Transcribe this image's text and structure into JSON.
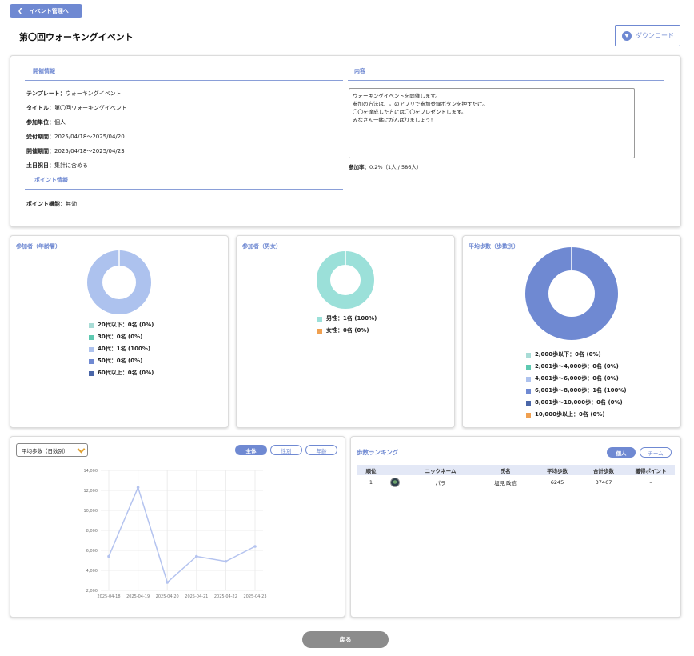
{
  "header": {
    "back_label": "イベント管理へ",
    "title": "第〇回ウォーキングイベント",
    "download_label": "ダウンロード"
  },
  "info": {
    "section_event": "開催情報",
    "section_content": "内容",
    "section_point": "ポイント情報",
    "rows": [
      {
        "label": "テンプレート：",
        "value": "ウォーキングイベント"
      },
      {
        "label": "タイトル：",
        "value": "第〇回ウォーキングイベント"
      },
      {
        "label": "参加単位：",
        "value": "個人"
      },
      {
        "label": "受付期間：",
        "value": "2025/04/18〜2025/04/20"
      },
      {
        "label": "開催期間：",
        "value": "2025/04/18〜2025/04/23"
      },
      {
        "label": "土日祝日：",
        "value": "集計に含める"
      }
    ],
    "point_row": {
      "label": "ポイント機能：",
      "value": "無効"
    },
    "content_lines": [
      "ウォーキングイベントを開催します。",
      "参加の方法は、このアプリで参加登録ボタンを押すだけ。",
      "〇〇を達成した方には〇〇をプレゼントします。",
      "みなさん一緒にがんばりましょう！"
    ],
    "rate_label": "参加率：",
    "rate_value": "0.2%（1人 / 586人）"
  },
  "charts": {
    "age": {
      "title": "参加者（年齢層）",
      "legend": [
        {
          "label": "20代以下：0名 (0%)",
          "color": "#a8dcd6"
        },
        {
          "label": "30代：0名 (0%)",
          "color": "#5ec9b1"
        },
        {
          "label": "40代：1名 (100%)",
          "color": "#adc2ee"
        },
        {
          "label": "50代：0名 (0%)",
          "color": "#6f89d2"
        },
        {
          "label": "60代以上：0名 (0%)",
          "color": "#4a66a8"
        }
      ]
    },
    "gender": {
      "title": "参加者（男女）",
      "legend": [
        {
          "label": "男性：1名 (100%)",
          "color": "#9be0d9"
        },
        {
          "label": "女性：0名 (0%)",
          "color": "#f0a050"
        }
      ]
    },
    "steps": {
      "title": "平均歩数（歩数別）",
      "legend": [
        {
          "label": "2,000歩以下：0名 (0%)",
          "color": "#a8dcd6"
        },
        {
          "label": "2,001歩〜4,000歩：0名 (0%)",
          "color": "#5ec9b1"
        },
        {
          "label": "4,001歩〜6,000歩：0名 (0%)",
          "color": "#adc2ee"
        },
        {
          "label": "6,001歩〜8,000歩：1名 (100%)",
          "color": "#6f89d2"
        },
        {
          "label": "8,001歩〜10,000歩：0名 (0%)",
          "color": "#4a66a8"
        },
        {
          "label": "10,000歩以上：0名 (0%)",
          "color": "#f0a050"
        }
      ]
    }
  },
  "line_panel": {
    "select_value": "平均歩数（日数別）",
    "tabs": [
      {
        "label": "全体",
        "active": true
      },
      {
        "label": "性別",
        "active": false
      },
      {
        "label": "年齢",
        "active": false
      }
    ]
  },
  "chart_data": [
    {
      "type": "pie",
      "title": "参加者（年齢層）",
      "categories": [
        "20代以下",
        "30代",
        "40代",
        "50代",
        "60代以上"
      ],
      "values": [
        0,
        0,
        1,
        0,
        0
      ]
    },
    {
      "type": "pie",
      "title": "参加者（男女）",
      "categories": [
        "男性",
        "女性"
      ],
      "values": [
        1,
        0
      ]
    },
    {
      "type": "pie",
      "title": "平均歩数（歩数別）",
      "categories": [
        "2,000歩以下",
        "2,001歩〜4,000歩",
        "4,001歩〜6,000歩",
        "6,001歩〜8,000歩",
        "8,001歩〜10,000歩",
        "10,000歩以上"
      ],
      "values": [
        0,
        0,
        0,
        1,
        0,
        0
      ]
    },
    {
      "type": "line",
      "x": [
        "2025-04-18",
        "2025-04-19",
        "2025-04-20",
        "2025-04-21",
        "2025-04-22",
        "2025-04-23"
      ],
      "series": [
        {
          "values": [
            5400,
            12300,
            2800,
            5400,
            4900,
            6400
          ]
        }
      ],
      "y_ticks": [
        "14,000",
        "12,000",
        "10,000",
        "8,000",
        "6,000",
        "4,000",
        "2,000"
      ],
      "ylim": [
        2000,
        14000
      ],
      "grid": true,
      "color": "#b4c3ef"
    }
  ],
  "ranking": {
    "title": "歩数ランキング",
    "tabs": [
      {
        "label": "個人",
        "active": true
      },
      {
        "label": "チーム",
        "active": false
      }
    ],
    "columns": [
      "順位",
      "",
      "ニックネーム",
      "氏名",
      "平均歩数",
      "合計歩数",
      "獲得ポイント"
    ],
    "rows": [
      {
        "rank": "1",
        "nickname": "パラ",
        "name": "塩見 政信",
        "avg": "6245",
        "total": "37467",
        "points": "–"
      }
    ]
  },
  "footer": {
    "back_label": "戻る"
  }
}
